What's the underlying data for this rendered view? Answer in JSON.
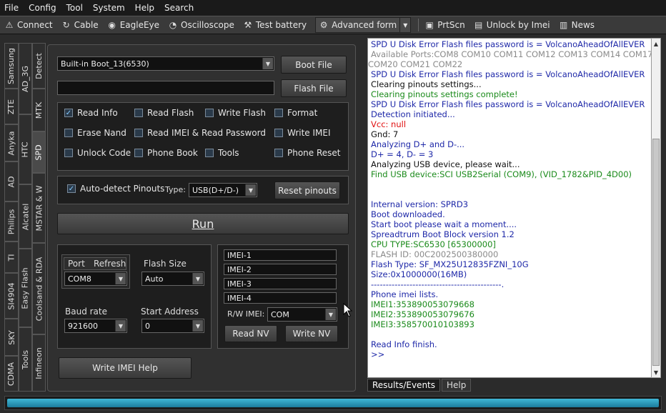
{
  "menu": [
    "File",
    "Config",
    "Tool",
    "System",
    "Help",
    "Search"
  ],
  "toolbar": {
    "connect": "Connect",
    "cable": "Cable",
    "eagleeye": "EagleEye",
    "oscilloscope": "Oscilloscope",
    "test_battery": "Test battery",
    "advanced_form": "Advanced form",
    "prtscn": "PrtScn",
    "unlock_imei": "Unlock by Imei",
    "news": "News"
  },
  "vtabs": {
    "c1": [
      "Samsung",
      "ZTE",
      "Anyka",
      "AD",
      "Philips",
      "TI",
      "SI4904",
      "SKY",
      "CDMA"
    ],
    "c2": [
      "AD_3G",
      "HTC",
      "Alcatel",
      "Easy Flash",
      "Tools"
    ],
    "c3": [
      "Detect",
      "MTK",
      "SPD",
      "MSTAR & W",
      "Coolsand & RDA",
      "Infineon"
    ]
  },
  "boot": {
    "combo": "Built-in Boot_13(6530)",
    "boot_file": "Boot File",
    "flash_file": "Flash File"
  },
  "options": {
    "read_info": "Read Info",
    "read_flash": "Read Flash",
    "write_flash": "Write Flash",
    "format": "Format",
    "erase_nand": "Erase Nand",
    "read_imei_pw": "Read IMEI & Read Password",
    "write_imei": "Write IMEI",
    "unlock_code": "Unlock Code",
    "phone_book": "Phone Book",
    "tools": "Tools",
    "phone_reset": "Phone Reset"
  },
  "pinouts": {
    "auto": "Auto-detect Pinouts",
    "type_label": "Type:",
    "type_value": "USB(D+/D-)",
    "reset": "Reset pinouts"
  },
  "run": "Run",
  "port": {
    "port": "Port",
    "refresh": "Refresh",
    "value": "COM8",
    "flash_size": "Flash Size",
    "flash_value": "Auto",
    "baud": "Baud rate",
    "baud_value": "921600",
    "start": "Start Address",
    "start_value": "0"
  },
  "imei": {
    "f1": "IMEI-1",
    "f2": "IMEI-2",
    "f3": "IMEI-3",
    "f4": "IMEI-4",
    "rw_label": "R/W IMEI:",
    "rw_value": "COM",
    "read_nv": "Read NV",
    "write_nv": "Write NV"
  },
  "write_imei_help": "Write IMEI Help",
  "colors": {
    "blue": "#1e28a8",
    "gray": "#8a8a8a",
    "green": "#1a8a1a",
    "red": "#e01010",
    "black": "#111111"
  },
  "log": [
    {
      "t": "SPD U Disk Error Flash files password is = VolcanoAheadOfAllEVER",
      "c": "blue"
    },
    {
      "t": "Available Ports:COM8 COM10 COM11 COM12 COM13 COM14 COM17",
      "c": "gray"
    },
    {
      "t": "COM20 COM21 COM22",
      "c": "gray",
      "indent": 0
    },
    {
      "t": "SPD U Disk Error Flash files password is = VolcanoAheadOfAllEVER",
      "c": "blue"
    },
    {
      "t": "Clearing pinouts settings...",
      "c": "black"
    },
    {
      "t": "Clearing pinouts settings complete!",
      "c": "green"
    },
    {
      "t": "SPD U Disk Error Flash files password is = VolcanoAheadOfAllEVER",
      "c": "blue"
    },
    {
      "t": "Detection initiated...",
      "c": "blue"
    },
    {
      "t": "Vcc: null",
      "c": "red"
    },
    {
      "t": "Gnd: 7",
      "c": "black"
    },
    {
      "t": "Analyzing D+ and D-...",
      "c": "blue"
    },
    {
      "t": "D+ = 4, D- = 3",
      "c": "blue"
    },
    {
      "t": "Analyzing USB device, please wait...",
      "c": "black"
    },
    {
      "t": "Find USB device:SCI USB2Serial (COM9), (VID_1782&PID_4D00)",
      "c": "green"
    },
    {
      "t": "",
      "c": "black"
    },
    {
      "t": "",
      "c": "black"
    },
    {
      "t": "Internal version: SPRD3",
      "c": "blue"
    },
    {
      "t": "Boot downloaded.",
      "c": "blue"
    },
    {
      "t": "Start boot please wait a moment....",
      "c": "blue"
    },
    {
      "t": "Spreadtrum Boot Block version 1.2",
      "c": "blue"
    },
    {
      "t": "CPU TYPE:SC6530 [65300000]",
      "c": "green"
    },
    {
      "t": "FLASH ID: 00C2002500380000",
      "c": "gray"
    },
    {
      "t": "Flash Type: SF_MX25U12835FZNI_10G",
      "c": "blue"
    },
    {
      "t": "Size:0x1000000(16MB)",
      "c": "blue"
    },
    {
      "t": "--------------------------------------------.",
      "c": "blue"
    },
    {
      "t": "Phone imei lists.",
      "c": "blue"
    },
    {
      "t": "IMEI1:353890053079668",
      "c": "green"
    },
    {
      "t": "IMEI2:353890053079676",
      "c": "green"
    },
    {
      "t": "IMEI3:358570010103893",
      "c": "green"
    },
    {
      "t": "",
      "c": "black"
    },
    {
      "t": "Read Info finish.",
      "c": "blue"
    },
    {
      "t": ">>",
      "c": "blue"
    }
  ],
  "bottom_tabs": [
    "Results/Events",
    "Help"
  ]
}
